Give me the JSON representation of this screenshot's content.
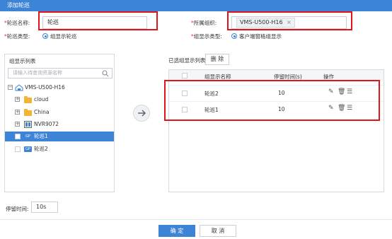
{
  "dialog": {
    "title": "添加轮巡"
  },
  "form": {
    "name_label": "轮巡名称:",
    "name_value": "轮巡",
    "org_label": "所属组织:",
    "org_value": "VMS-U500-H16",
    "org_clear": "×",
    "type_label": "轮巡类型:",
    "type_value": "组显示轮巡",
    "group_type_label": "组显示类型:",
    "group_type_value": "客户端窗格组显示"
  },
  "left_panel": {
    "title": "组显示列表",
    "search_placeholder": "请输入待查询资源名称",
    "tree": [
      {
        "label": "VMS-U500-H16",
        "icon": "server-icon",
        "expander": "−"
      },
      {
        "label": "cloud",
        "icon": "folder-icon",
        "expander": "+"
      },
      {
        "label": "China",
        "icon": "folder-icon",
        "expander": "+"
      },
      {
        "label": "NVR9072",
        "icon": "nvr-icon",
        "expander": "+"
      },
      {
        "label": "轮巡1",
        "icon": "group-display-icon",
        "selected": true
      },
      {
        "label": "轮巡2",
        "icon": "group-display-icon"
      }
    ]
  },
  "right_panel": {
    "title": "已选组显示列表",
    "delete_label": "删 除",
    "columns": [
      "组显示名称",
      "停留时间(s)",
      "操作"
    ],
    "rows": [
      {
        "name": "轮巡2",
        "time": "10"
      },
      {
        "name": "轮巡1",
        "time": "10"
      }
    ]
  },
  "dwell": {
    "label": "停留时间:",
    "value": "10s"
  },
  "footer": {
    "ok": "确 定",
    "cancel": "取 消"
  },
  "colors": {
    "accent": "#3d83d6",
    "highlight": "#e0151c"
  }
}
